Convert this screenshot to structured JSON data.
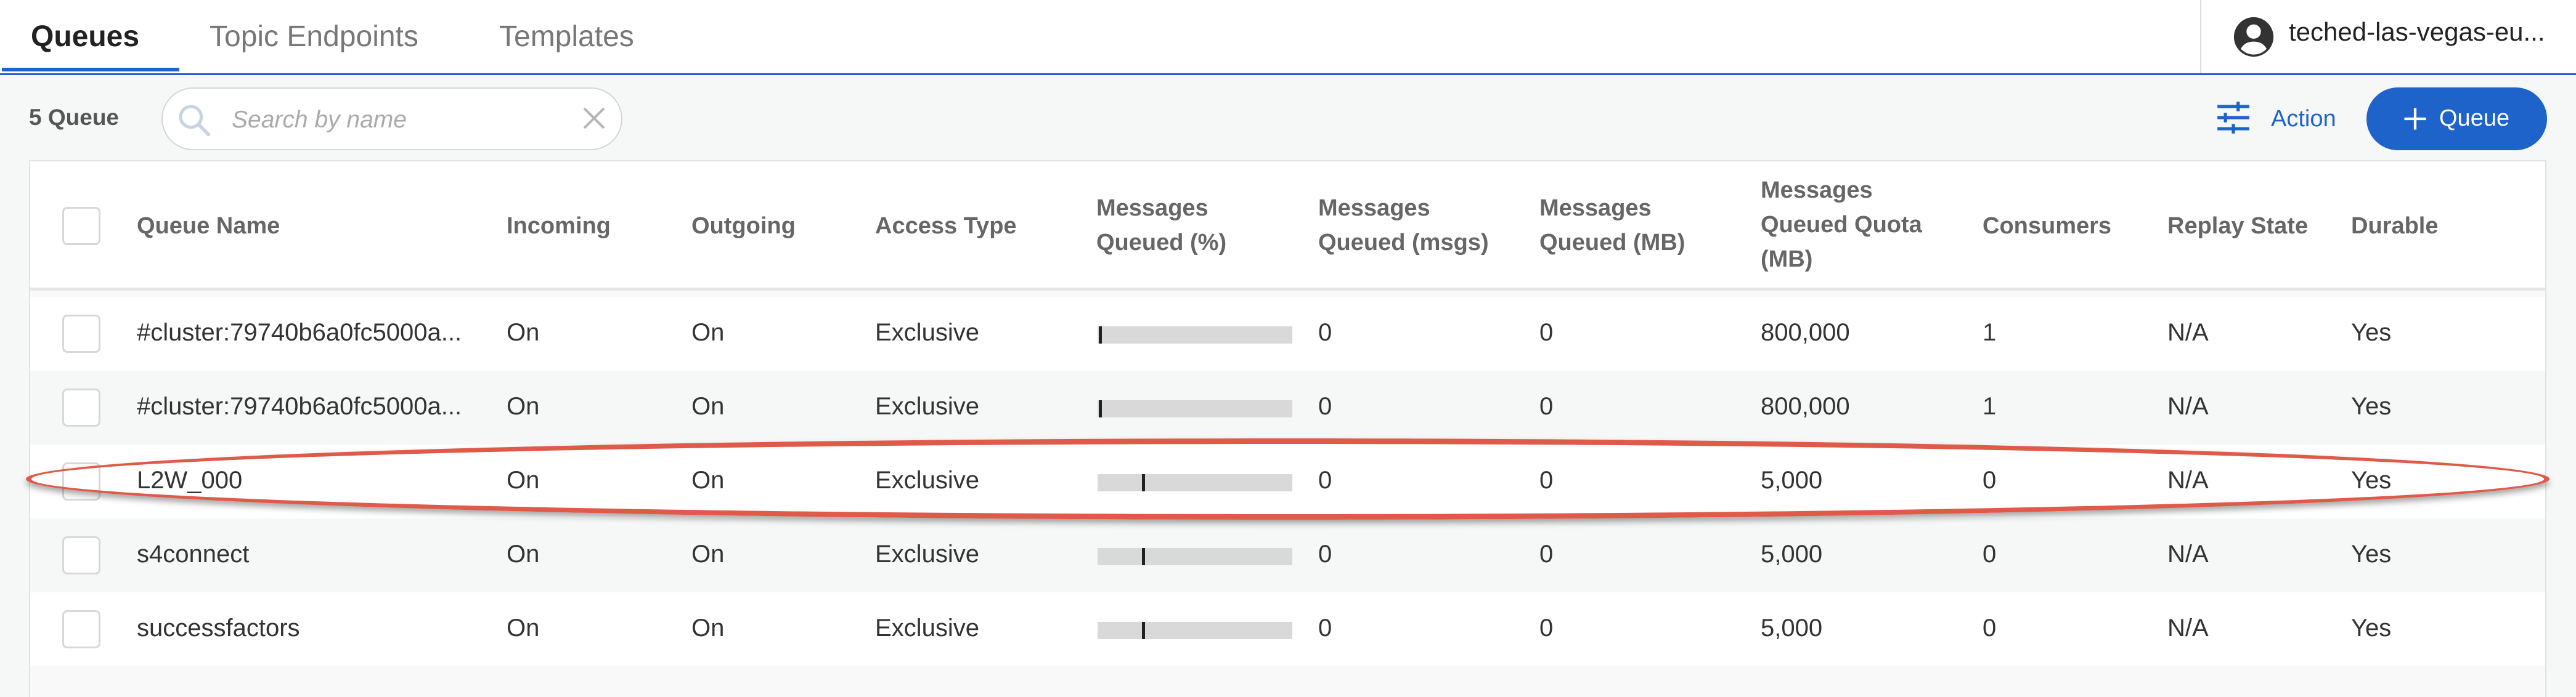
{
  "tabs": [
    "Queues",
    "Topic Endpoints",
    "Templates"
  ],
  "user": {
    "name": "teched-las-vegas-eu..."
  },
  "toolbar": {
    "count_label": "5 Queue",
    "search_placeholder": "Search by name",
    "action_label": "Action",
    "add_queue_label": "Queue"
  },
  "columns": {
    "queue_name": "Queue Name",
    "incoming": "Incoming",
    "outgoing": "Outgoing",
    "access_type": "Access Type",
    "msgs_pct_1": "Messages",
    "msgs_pct_2": "Queued (%)",
    "msgs_count_1": "Messages",
    "msgs_count_2": "Queued (msgs)",
    "msgs_mb_1": "Messages",
    "msgs_mb_2": "Queued (MB)",
    "quota_1": "Messages",
    "quota_2": "Queued Quota",
    "quota_3": "(MB)",
    "consumers": "Consumers",
    "replay_state": "Replay State",
    "durable": "Durable"
  },
  "rows": [
    {
      "name": "#cluster:79740b6a0fc5000a...",
      "incoming": "On",
      "outgoing": "On",
      "access": "Exclusive",
      "queued_pct": 0,
      "queued_msgs": "0",
      "queued_mb": "0",
      "quota": "800,000",
      "consumers": "1",
      "replay": "N/A",
      "durable": "Yes"
    },
    {
      "name": "#cluster:79740b6a0fc5000a...",
      "incoming": "On",
      "outgoing": "On",
      "access": "Exclusive",
      "queued_pct": 0,
      "queued_msgs": "0",
      "queued_mb": "0",
      "quota": "800,000",
      "consumers": "1",
      "replay": "N/A",
      "durable": "Yes"
    },
    {
      "name": "L2W_000",
      "incoming": "On",
      "outgoing": "On",
      "access": "Exclusive",
      "queued_pct": 0,
      "queued_msgs": "0",
      "queued_mb": "0",
      "quota": "5,000",
      "consumers": "0",
      "replay": "N/A",
      "durable": "Yes"
    },
    {
      "name": "s4connect",
      "incoming": "On",
      "outgoing": "On",
      "access": "Exclusive",
      "queued_pct": 0,
      "queued_msgs": "0",
      "queued_mb": "0",
      "quota": "5,000",
      "consumers": "0",
      "replay": "N/A",
      "durable": "Yes"
    },
    {
      "name": "successfactors",
      "incoming": "On",
      "outgoing": "On",
      "access": "Exclusive",
      "queued_pct": 0,
      "queued_msgs": "0",
      "queued_mb": "0",
      "quota": "5,000",
      "consumers": "0",
      "replay": "N/A",
      "durable": "Yes"
    }
  ],
  "colors": {
    "accent": "#1e63c9",
    "highlight": "#e05a4a"
  },
  "icons": [
    "user-icon",
    "search-icon",
    "clear-icon",
    "sliders-icon",
    "plus-icon"
  ]
}
